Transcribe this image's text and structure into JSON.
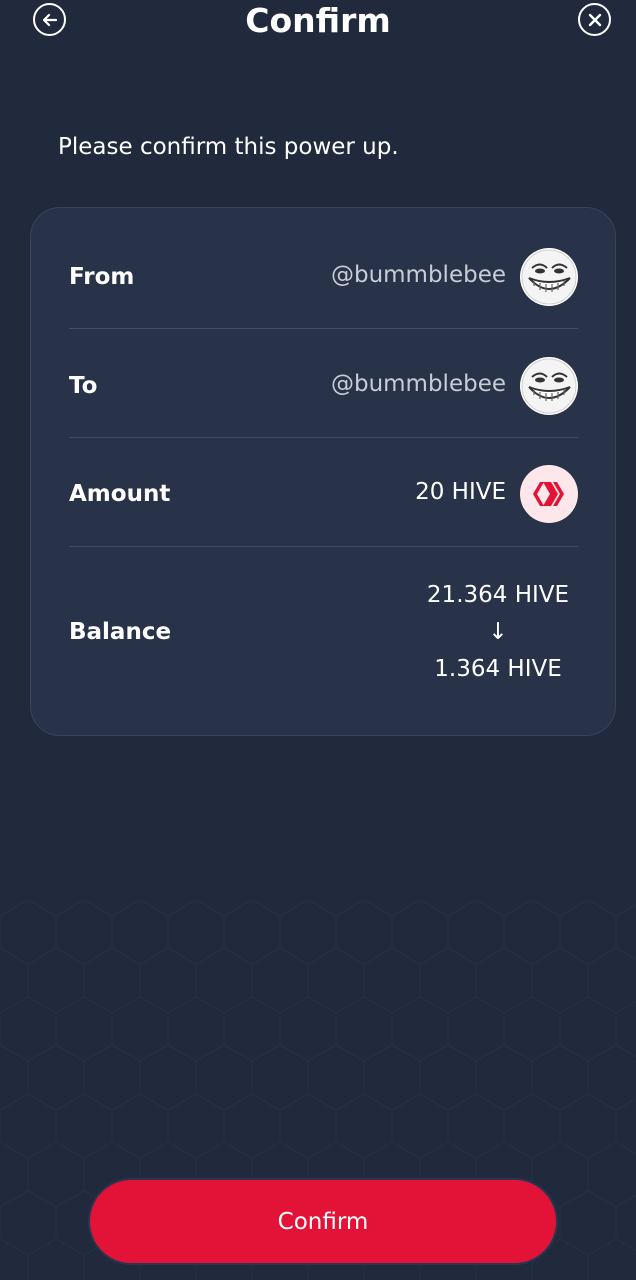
{
  "header": {
    "title": "Confirm",
    "back_icon": "arrow-left-circle-icon",
    "close_icon": "close-circle-icon"
  },
  "subtitle": "Please confirm this power up.",
  "rows": {
    "from": {
      "label": "From",
      "value": "@bummblebee"
    },
    "to": {
      "label": "To",
      "value": "@bummblebee"
    },
    "amount": {
      "label": "Amount",
      "value": "20 HIVE"
    },
    "balance": {
      "label": "Balance",
      "before": "21.364 HIVE",
      "arrow": "↓",
      "after": "1.364 HIVE"
    }
  },
  "confirm_button": {
    "label": "Confirm"
  },
  "colors": {
    "background": "#212a3d",
    "card": "#283249",
    "accent": "#e31337"
  }
}
